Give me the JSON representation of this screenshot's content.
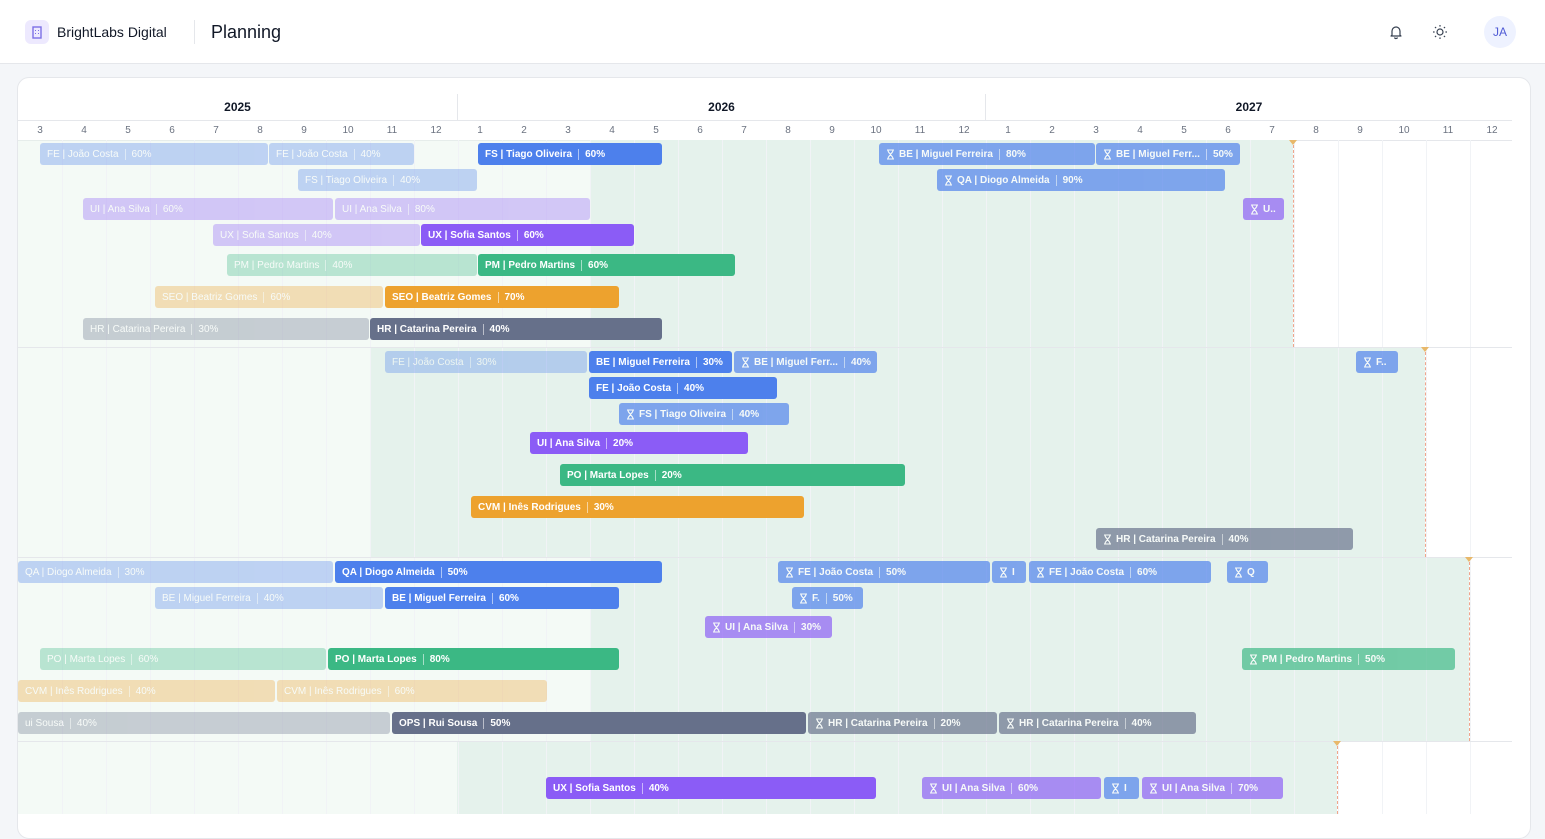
{
  "header": {
    "brand": "BrightLabs Digital",
    "title": "Planning",
    "avatar_initials": "JA"
  },
  "icons": {
    "logo": "building-icon",
    "notifications": "bell-icon",
    "theme": "sun-icon",
    "pending": "hourglass-icon"
  },
  "colors": {
    "FE": "#4d80ec",
    "BE": "#4d80ec",
    "FS": "#4d80ec",
    "QA": "#4d80ec",
    "UI": "#8b5cf6",
    "UX": "#8b5cf6",
    "PM": "#3bb884",
    "PO": "#3bb884",
    "SEO": "#eda22e",
    "CVM": "#eda22e",
    "HR": "#66708a",
    "OPS": "#66708a"
  },
  "timeline": {
    "years": [
      "2025",
      "2026",
      "2027"
    ],
    "months": [
      "3",
      "4",
      "5",
      "6",
      "7",
      "8",
      "9",
      "10",
      "11",
      "12",
      "1",
      "2",
      "3",
      "4",
      "5",
      "6",
      "7",
      "8",
      "9",
      "10",
      "11",
      "12",
      "1",
      "2",
      "3",
      "4",
      "5",
      "6",
      "7",
      "8",
      "9",
      "10",
      "11",
      "12"
    ]
  },
  "bars": [
    {
      "label": "FE | João Costa",
      "pct": "60%",
      "status": "past"
    },
    {
      "label": "FE | João Costa",
      "pct": "40%",
      "status": "past"
    },
    {
      "label": "FS | Tiago Oliveira",
      "pct": "60%",
      "status": "active"
    },
    {
      "label": "BE | Miguel Ferreira",
      "pct": "80%",
      "status": "pending"
    },
    {
      "label": "BE | Miguel Ferr...",
      "pct": "50%",
      "status": "pending"
    },
    {
      "label": "FS | Tiago Oliveira",
      "pct": "40%",
      "status": "past"
    },
    {
      "label": "QA | Diogo Almeida",
      "pct": "90%",
      "status": "pending"
    },
    {
      "label": "UI | Ana Silva",
      "pct": "60%",
      "status": "past"
    },
    {
      "label": "UI | Ana Silva",
      "pct": "80%",
      "status": "past"
    },
    {
      "label": "U..",
      "pct": "",
      "status": "pending"
    },
    {
      "label": "UX | Sofia Santos",
      "pct": "40%",
      "status": "past"
    },
    {
      "label": "UX | Sofia Santos",
      "pct": "60%",
      "status": "active"
    },
    {
      "label": "PM | Pedro Martins",
      "pct": "40%",
      "status": "past"
    },
    {
      "label": "PM | Pedro Martins",
      "pct": "60%",
      "status": "active"
    },
    {
      "label": "SEO | Beatriz Gomes",
      "pct": "60%",
      "status": "past"
    },
    {
      "label": "SEO | Beatriz Gomes",
      "pct": "70%",
      "status": "active"
    },
    {
      "label": "HR | Catarina Pereira",
      "pct": "30%",
      "status": "past"
    },
    {
      "label": "HR | Catarina Pereira",
      "pct": "40%",
      "status": "active"
    },
    {
      "label": "FE | João Costa",
      "pct": "30%",
      "status": "past"
    },
    {
      "label": "BE | Miguel Ferreira",
      "pct": "30%",
      "status": "active"
    },
    {
      "label": "BE | Miguel Ferr...",
      "pct": "40%",
      "status": "pending"
    },
    {
      "label": "F..",
      "pct": "",
      "status": "pending"
    },
    {
      "label": "FE | João Costa",
      "pct": "40%",
      "status": "active"
    },
    {
      "label": "FS | Tiago Oliveira",
      "pct": "40%",
      "status": "pending"
    },
    {
      "label": "UI | Ana Silva",
      "pct": "20%",
      "status": "active"
    },
    {
      "label": "PO | Marta Lopes",
      "pct": "20%",
      "status": "active"
    },
    {
      "label": "CVM | Inês Rodrigues",
      "pct": "30%",
      "status": "active"
    },
    {
      "label": "HR | Catarina Pereira",
      "pct": "40%",
      "status": "pending"
    },
    {
      "label": "QA | Diogo Almeida",
      "pct": "30%",
      "status": "past"
    },
    {
      "label": "QA | Diogo Almeida",
      "pct": "50%",
      "status": "active"
    },
    {
      "label": "FE | João Costa",
      "pct": "50%",
      "status": "pending"
    },
    {
      "label": "I",
      "pct": "",
      "status": "pending"
    },
    {
      "label": "FE | João Costa",
      "pct": "60%",
      "status": "pending"
    },
    {
      "label": "Q",
      "pct": "",
      "status": "pending"
    },
    {
      "label": "BE | Miguel Ferreira",
      "pct": "40%",
      "status": "past"
    },
    {
      "label": "BE | Miguel Ferreira",
      "pct": "60%",
      "status": "active"
    },
    {
      "label": "F.",
      "pct": "50%",
      "status": "pending"
    },
    {
      "label": "UI | Ana Silva",
      "pct": "30%",
      "status": "pending"
    },
    {
      "label": "PO | Marta Lopes",
      "pct": "60%",
      "status": "past"
    },
    {
      "label": "PO | Marta Lopes",
      "pct": "80%",
      "status": "active"
    },
    {
      "label": "PM | Pedro Martins",
      "pct": "50%",
      "status": "pending"
    },
    {
      "label": "CVM | Inês Rodrigues",
      "pct": "40%",
      "status": "past"
    },
    {
      "label": "CVM | Inês Rodrigues",
      "pct": "60%",
      "status": "past"
    },
    {
      "label": "ui Sousa",
      "pct": "40%",
      "status": "past"
    },
    {
      "label": "OPS | Rui Sousa",
      "pct": "50%",
      "status": "active"
    },
    {
      "label": "HR | Catarina Pereira",
      "pct": "20%",
      "status": "pending"
    },
    {
      "label": "HR | Catarina Pereira",
      "pct": "40%",
      "status": "pending"
    },
    {
      "label": "UX | Sofia Santos",
      "pct": "40%",
      "status": "active"
    },
    {
      "label": "UI | Ana Silva",
      "pct": "60%",
      "status": "pending"
    },
    {
      "label": "I",
      "pct": "",
      "status": "pending"
    },
    {
      "label": "UI | Ana Silva",
      "pct": "70%",
      "status": "pending"
    }
  ]
}
